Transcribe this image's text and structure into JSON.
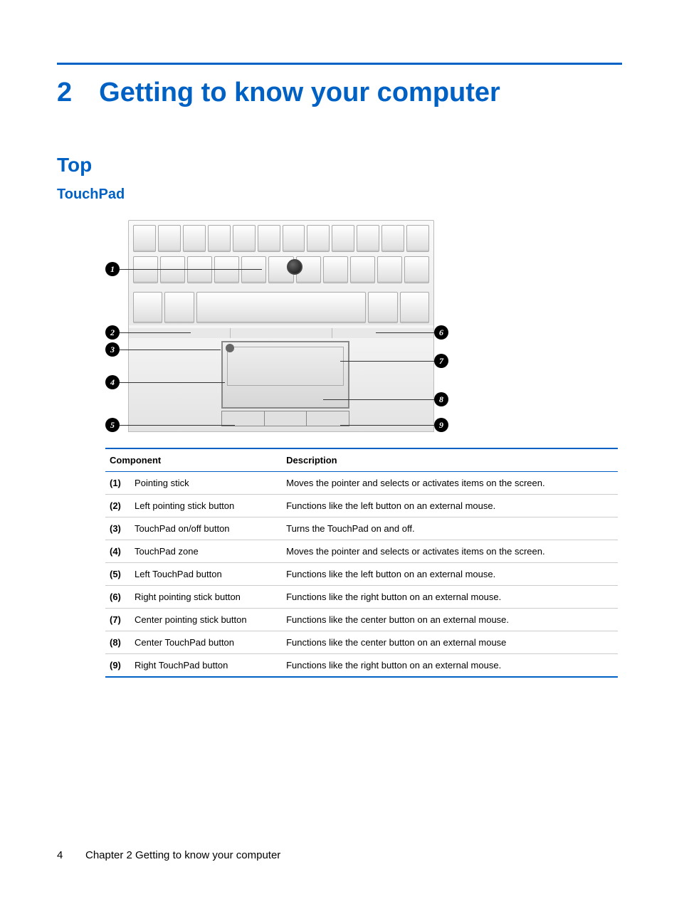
{
  "chapter": {
    "number": "2",
    "title": "Getting to know your computer"
  },
  "sections": {
    "top": "Top",
    "touchpad": "TouchPad"
  },
  "callouts": [
    "1",
    "2",
    "3",
    "4",
    "5",
    "6",
    "7",
    "8",
    "9"
  ],
  "table": {
    "headers": {
      "component": "Component",
      "description": "Description"
    },
    "rows": [
      {
        "num": "(1)",
        "name": "Pointing stick",
        "desc": "Moves the pointer and selects or activates items on the screen."
      },
      {
        "num": "(2)",
        "name": "Left pointing stick button",
        "desc": "Functions like the left button on an external mouse."
      },
      {
        "num": "(3)",
        "name": "TouchPad on/off button",
        "desc": "Turns the TouchPad on and off."
      },
      {
        "num": "(4)",
        "name": "TouchPad zone",
        "desc": "Moves the pointer and selects or activates items on the screen."
      },
      {
        "num": "(5)",
        "name": "Left TouchPad button",
        "desc": "Functions like the left button on an external mouse."
      },
      {
        "num": "(6)",
        "name": "Right pointing stick button",
        "desc": "Functions like the right button on an external mouse."
      },
      {
        "num": "(7)",
        "name": "Center pointing stick button",
        "desc": "Functions like the center button on an external mouse."
      },
      {
        "num": "(8)",
        "name": "Center TouchPad button",
        "desc": "Functions like the center button on an external mouse"
      },
      {
        "num": "(9)",
        "name": "Right TouchPad button",
        "desc": "Functions like the right button on an external mouse."
      }
    ]
  },
  "footer": {
    "page": "4",
    "text": "Chapter 2   Getting to know your computer"
  }
}
